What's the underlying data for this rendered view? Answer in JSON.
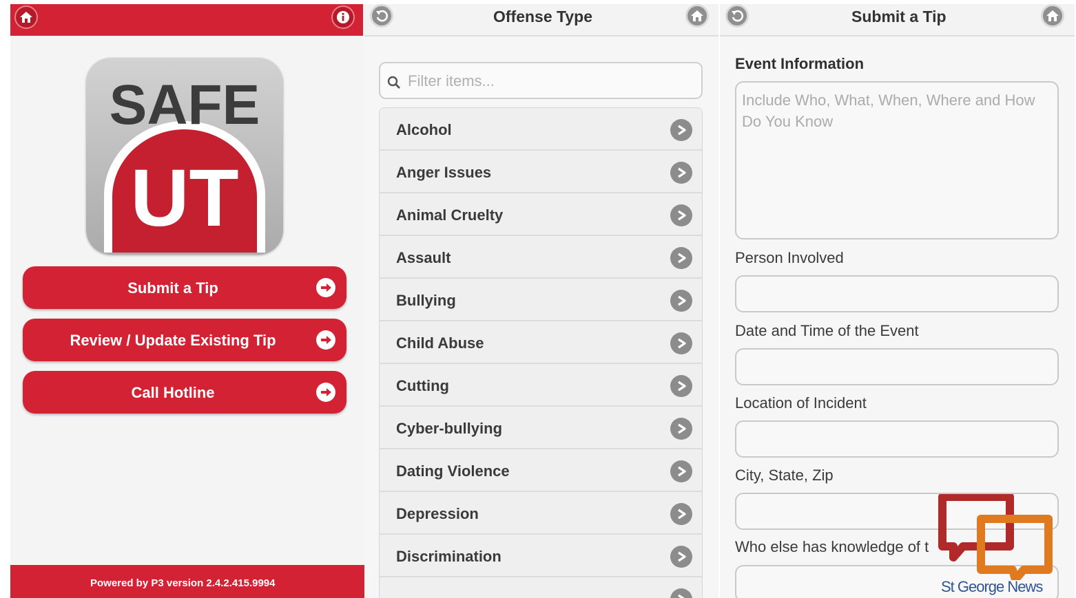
{
  "home": {
    "header": {
      "home_icon": "home-icon",
      "info_icon": "info-icon"
    },
    "logo": {
      "top_text": "SAFE",
      "bottom_text": "UT"
    },
    "buttons": [
      {
        "label": "Submit a Tip"
      },
      {
        "label": "Review / Update Existing Tip"
      },
      {
        "label": "Call Hotline"
      }
    ],
    "footer": "Powered by P3 version 2.4.2.415.9994"
  },
  "offense": {
    "title": "Offense Type",
    "back_icon": "back-icon",
    "home_icon": "home-icon",
    "filter_placeholder": "Filter items...",
    "items": [
      "Alcohol",
      "Anger Issues",
      "Animal Cruelty",
      "Assault",
      "Bullying",
      "Child Abuse",
      "Cutting",
      "Cyber-bullying",
      "Dating Violence",
      "Depression",
      "Discrimination",
      ""
    ]
  },
  "tip": {
    "title": "Submit a Tip",
    "section": "Event Information",
    "event_placeholder": "Include Who, What, When, Where and How Do You Know",
    "fields": [
      {
        "label": "Person Involved"
      },
      {
        "label": "Date and Time of the Event"
      },
      {
        "label": "Location of Incident"
      },
      {
        "label": "City, State, Zip"
      },
      {
        "label": "Who else has knowledge of t"
      }
    ]
  },
  "watermark": {
    "text": "St George News"
  },
  "colors": {
    "brand_red": "#d42235",
    "icon_grey": "#8c8c8c",
    "background": "#f4f4f4"
  }
}
